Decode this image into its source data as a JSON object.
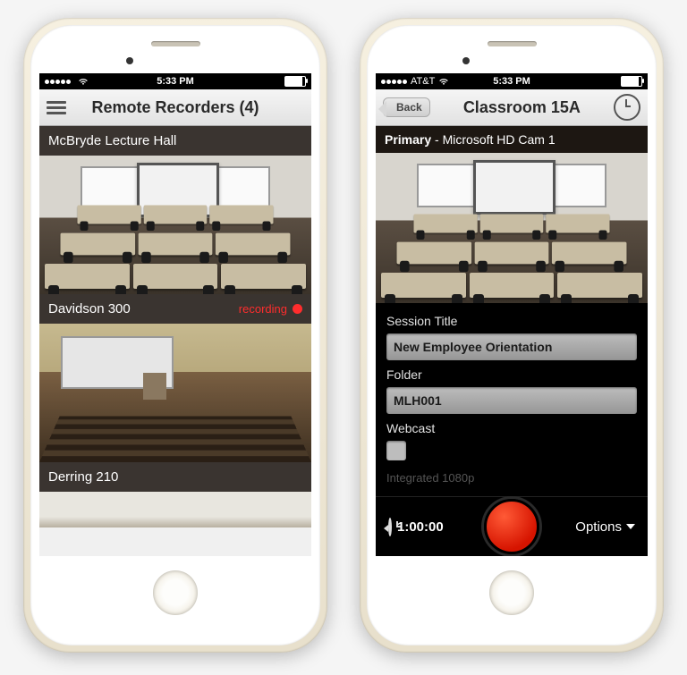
{
  "left": {
    "status": {
      "carrier": "",
      "time": "5:33 PM"
    },
    "nav": {
      "title": "Remote Recorders (4)"
    },
    "rooms": [
      {
        "name": "McBryde Lecture Hall",
        "recording": false
      },
      {
        "name": "Davidson 300",
        "recording": true,
        "recording_label": "recording"
      },
      {
        "name": "Derring 210",
        "recording": false
      }
    ]
  },
  "right": {
    "status": {
      "carrier": "AT&T",
      "time": "5:33 PM"
    },
    "nav": {
      "back": "Back",
      "title": "Classroom 15A"
    },
    "preview": {
      "label": "Primary",
      "source": "Microsoft HD Cam 1"
    },
    "form": {
      "session_label": "Session Title",
      "session_value": "New Employee Orientation",
      "folder_label": "Folder",
      "folder_value": "MLH001",
      "webcast_label": "Webcast",
      "ghost": "Integrated 1080p"
    },
    "bottom": {
      "duration": "1:00:00",
      "options": "Options"
    }
  }
}
